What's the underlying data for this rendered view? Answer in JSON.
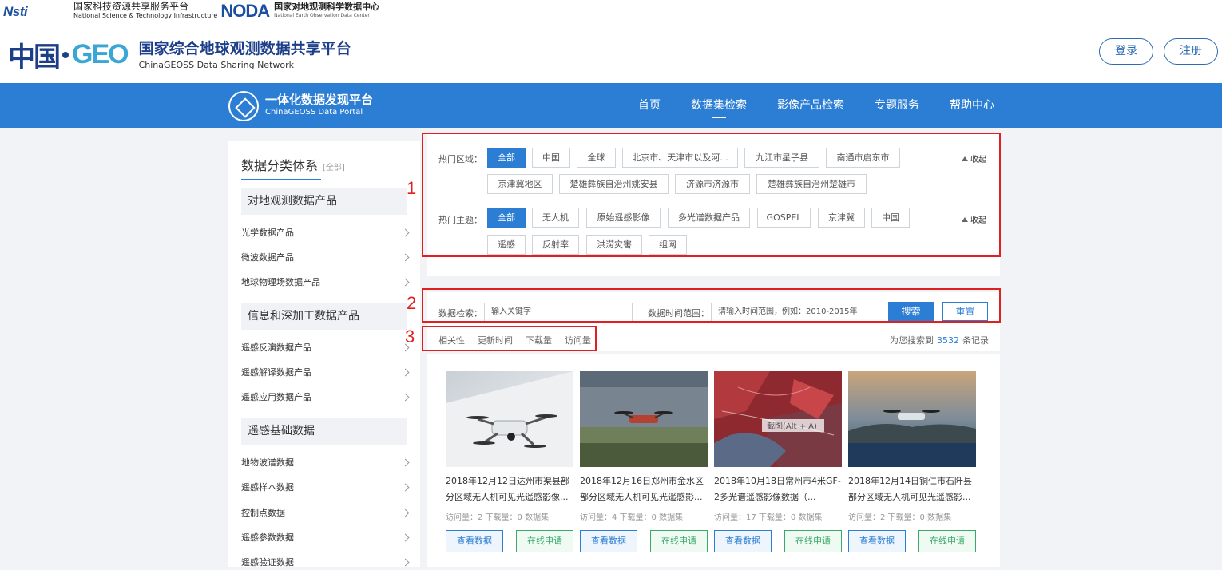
{
  "partners": {
    "nsti_logo": "Nsti",
    "nsti_cn": "国家科技资源共享服务平台",
    "nsti_en": "National Science & Technology Infrastructure",
    "noda_logo": "NODA",
    "noda_cn": "国家对地观测科学数据中心",
    "noda_en": "National Earth Observation Data Center"
  },
  "brand": {
    "zhongguo": "中国",
    "geo": "GEO",
    "title_cn": "国家综合地球观测数据共享平台",
    "title_en": "ChinaGEOSS Data Sharing Network"
  },
  "auth": {
    "login": "登录",
    "register": "注册"
  },
  "portal": {
    "cn": "一体化数据发现平台",
    "en": "ChinaGEOSS Data Portal"
  },
  "menu": [
    {
      "label": "首页"
    },
    {
      "label": "数据集检索"
    },
    {
      "label": "影像产品检索"
    },
    {
      "label": "专题服务"
    },
    {
      "label": "帮助中心"
    }
  ],
  "sidebar": {
    "heading": "数据分类体系",
    "all_link": "[全部]",
    "categories": [
      {
        "label": "对地观测数据产品",
        "items": [
          "光学数据产品",
          "微波数据产品",
          "地球物理场数据产品"
        ]
      },
      {
        "label": "信息和深加工数据产品",
        "items": [
          "遥感反演数据产品",
          "遥感解译数据产品",
          "遥感应用数据产品"
        ]
      },
      {
        "label": "遥感基础数据",
        "items": [
          "地物波谱数据",
          "遥感样本数据",
          "控制点数据",
          "遥感参数数据",
          "遥感验证数据"
        ]
      }
    ]
  },
  "filters": {
    "region_label": "热门区域：",
    "regions": [
      "全部",
      "中国",
      "全球",
      "北京市、天津市以及河...",
      "九江市星子县",
      "南通市启东市",
      "京津冀地区",
      "楚雄彝族自治州姚安县",
      "济源市济源市",
      "楚雄彝族自治州楚雄市"
    ],
    "topic_label": "热门主题：",
    "topics": [
      "全部",
      "无人机",
      "原始遥感影像",
      "多光谱数据产品",
      "GOSPEL",
      "京津冀",
      "中国",
      "遥感",
      "反射率",
      "洪涝灾害",
      "组网"
    ],
    "collapse": "收起"
  },
  "search": {
    "label": "数据检索：",
    "keyword_placeholder": "输入关键字",
    "time_label": "数据时间范围：",
    "time_placeholder": "请输入时间范围，例如：2010-2015年",
    "search_btn": "搜索",
    "reset_btn": "重置"
  },
  "sort": {
    "options": [
      "相关性",
      "更新时间",
      "下载量",
      "访问量"
    ],
    "count_prefix": "为您搜索到",
    "count": "3532",
    "count_suffix": "条记录"
  },
  "cards": [
    {
      "title": "2018年12月12日达州市渠县部分区域无人机可见光遥感影像...",
      "meta": "访问量：2    下载量：0    数据集",
      "view": "查看数据",
      "apply": "在线申请"
    },
    {
      "title": "2018年12月16日郑州市金水区部分区域无人机可见光遥感影...",
      "meta": "访问量：4    下载量：0    数据集",
      "view": "查看数据",
      "apply": "在线申请"
    },
    {
      "title": "2018年10月18日常州市4米GF-2多光谱遥感影像数据（...",
      "meta": "访问量：17    下载量：0    数据集",
      "view": "查看数据",
      "apply": "在线申请",
      "overlay": "截图(Alt + A)"
    },
    {
      "title": "2018年12月14日铜仁市石阡县部分区域无人机可见光遥感影...",
      "meta": "访问量：2    下载量：0    数据集",
      "view": "查看数据",
      "apply": "在线申请"
    }
  ],
  "annotations": [
    "1",
    "2",
    "3"
  ],
  "colors": {
    "primary": "#2c7ed4",
    "green": "#3aa86a",
    "annotation_red": "#e02020"
  }
}
